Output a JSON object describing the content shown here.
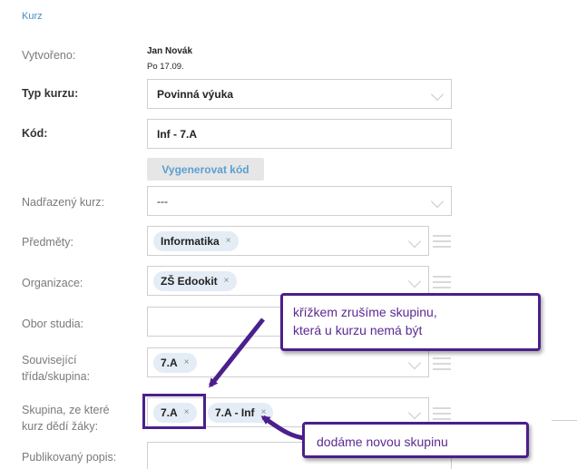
{
  "section_title": "Kurz",
  "created": {
    "label": "Vytvořeno:",
    "name": "Jan Novák",
    "date": "Po 17.09."
  },
  "course_type": {
    "label": "Typ kurzu:",
    "value": "Povinná výuka"
  },
  "code": {
    "label": "Kód:",
    "value": "Inf - 7.A",
    "generate_label": "Vygenerovat kód"
  },
  "parent_course": {
    "label": "Nadřazený kurz:",
    "value": "---"
  },
  "subjects": {
    "label": "Předměty:",
    "chips": [
      "Informatika"
    ]
  },
  "organization": {
    "label": "Organizace:",
    "chips": [
      "ZŠ Edookit"
    ]
  },
  "field_of_study": {
    "label": "Obor studia:",
    "value": ""
  },
  "related_class": {
    "label_line1": "Související",
    "label_line2": "třída/skupina:",
    "chips": [
      "7.A"
    ]
  },
  "inherit_group": {
    "label_line1": "Skupina, ze které",
    "label_line2": "kurz dědí žáky:",
    "chips": [
      "7.A",
      "7.A - Inf"
    ]
  },
  "published_desc": {
    "label": "Publikovaný popis:"
  },
  "chip_remove_glyph": "×",
  "callout_top": {
    "line1": "křížkem zrušíme skupinu,",
    "line2": "která u kurzu nemá být"
  },
  "callout_bottom": {
    "text": "dodáme novou skupinu"
  },
  "colors": {
    "link": "#3d8fc4",
    "chip_bg": "#e4ecf5",
    "annotation": "#4b1f8c",
    "annotation_text": "#5a2a92"
  }
}
